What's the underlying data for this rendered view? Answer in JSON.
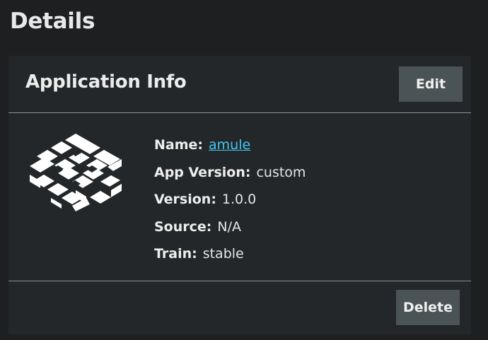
{
  "page": {
    "title": "Details"
  },
  "card": {
    "title": "Application Info",
    "edit_label": "Edit",
    "delete_label": "Delete",
    "icon": "app-grid-icon",
    "fields": [
      {
        "label": "Name:",
        "value": "amule",
        "is_link": true
      },
      {
        "label": "App Version:",
        "value": "custom"
      },
      {
        "label": "Version:",
        "value": "1.0.0"
      },
      {
        "label": "Source:",
        "value": "N/A"
      },
      {
        "label": "Train:",
        "value": "stable"
      }
    ]
  },
  "colors": {
    "background": "#1e1f21",
    "card": "#232729",
    "button": "#4a5356",
    "link": "#42c9f0"
  }
}
